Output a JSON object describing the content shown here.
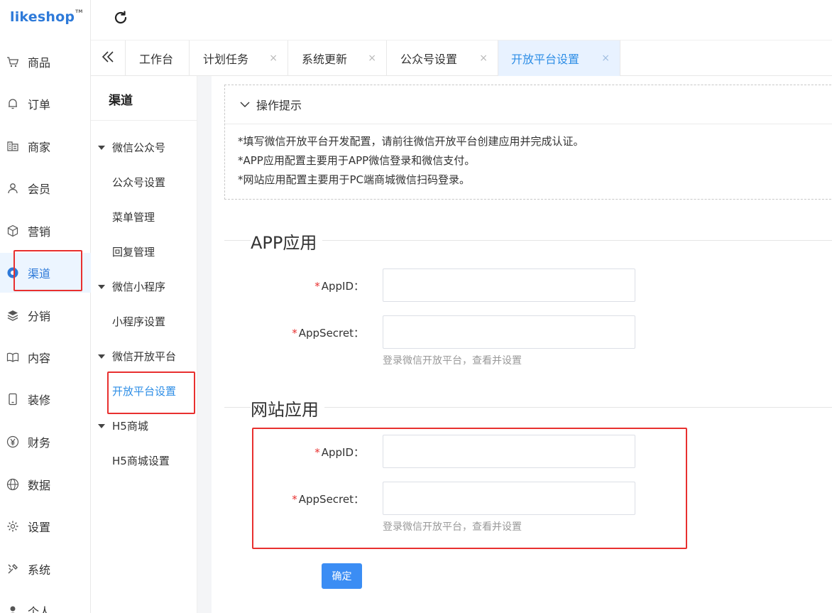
{
  "brand": {
    "logo_text": "likeshop",
    "tm": "TM"
  },
  "sidebar": {
    "items": [
      {
        "label": "商品",
        "icon": "cart-icon"
      },
      {
        "label": "订单",
        "icon": "bell-icon"
      },
      {
        "label": "商家",
        "icon": "store-icon"
      },
      {
        "label": "会员",
        "icon": "user-icon"
      },
      {
        "label": "营销",
        "icon": "cube-icon"
      },
      {
        "label": "渠道",
        "icon": "channel-icon"
      },
      {
        "label": "分销",
        "icon": "layers-icon"
      },
      {
        "label": "内容",
        "icon": "book-icon"
      },
      {
        "label": "装修",
        "icon": "phone-icon"
      },
      {
        "label": "财务",
        "icon": "yen-icon"
      },
      {
        "label": "数据",
        "icon": "globe-icon"
      },
      {
        "label": "设置",
        "icon": "gear-icon"
      },
      {
        "label": "系统",
        "icon": "tools-icon"
      },
      {
        "label": "个人",
        "icon": "person-icon"
      }
    ],
    "active": "渠道"
  },
  "tabs": [
    {
      "label": "工作台",
      "closable": false
    },
    {
      "label": "计划任务",
      "closable": true
    },
    {
      "label": "系统更新",
      "closable": true
    },
    {
      "label": "公众号设置",
      "closable": true
    },
    {
      "label": "开放平台设置",
      "closable": true,
      "active": true
    }
  ],
  "tab_close_glyph": "×",
  "subside": {
    "title": "渠道",
    "groups": [
      {
        "label": "微信公众号",
        "items": [
          "公众号设置",
          "菜单管理",
          "回复管理"
        ]
      },
      {
        "label": "微信小程序",
        "items": [
          "小程序设置"
        ]
      },
      {
        "label": "微信开放平台",
        "items": [
          "开放平台设置"
        ]
      },
      {
        "label": "H5商城",
        "items": [
          "H5商城设置"
        ]
      }
    ],
    "active_item": "开放平台设置"
  },
  "tips": {
    "title": "操作提示",
    "lines": [
      "*填写微信开放平台开发配置，请前往微信开放平台创建应用并完成认证。",
      "*APP应用配置主要用于APP微信登录和微信支付。",
      "*网站应用配置主要用于PC端商城微信扫码登录。"
    ]
  },
  "app_section": {
    "title": "APP应用",
    "appid_label": "AppID：",
    "appid_value": "",
    "secret_label": "AppSecret：",
    "secret_value": "",
    "hint": "登录微信开放平台，查看并设置"
  },
  "web_section": {
    "title": "网站应用",
    "appid_label": "AppID：",
    "appid_value": "",
    "secret_label": "AppSecret：",
    "secret_value": "",
    "hint": "登录微信开放平台，查看并设置"
  },
  "required_mark": "*",
  "confirm_label": "确定",
  "colors": {
    "accent": "#2e8ee6",
    "highlight": "#e8302f",
    "button": "#3b8df4"
  }
}
